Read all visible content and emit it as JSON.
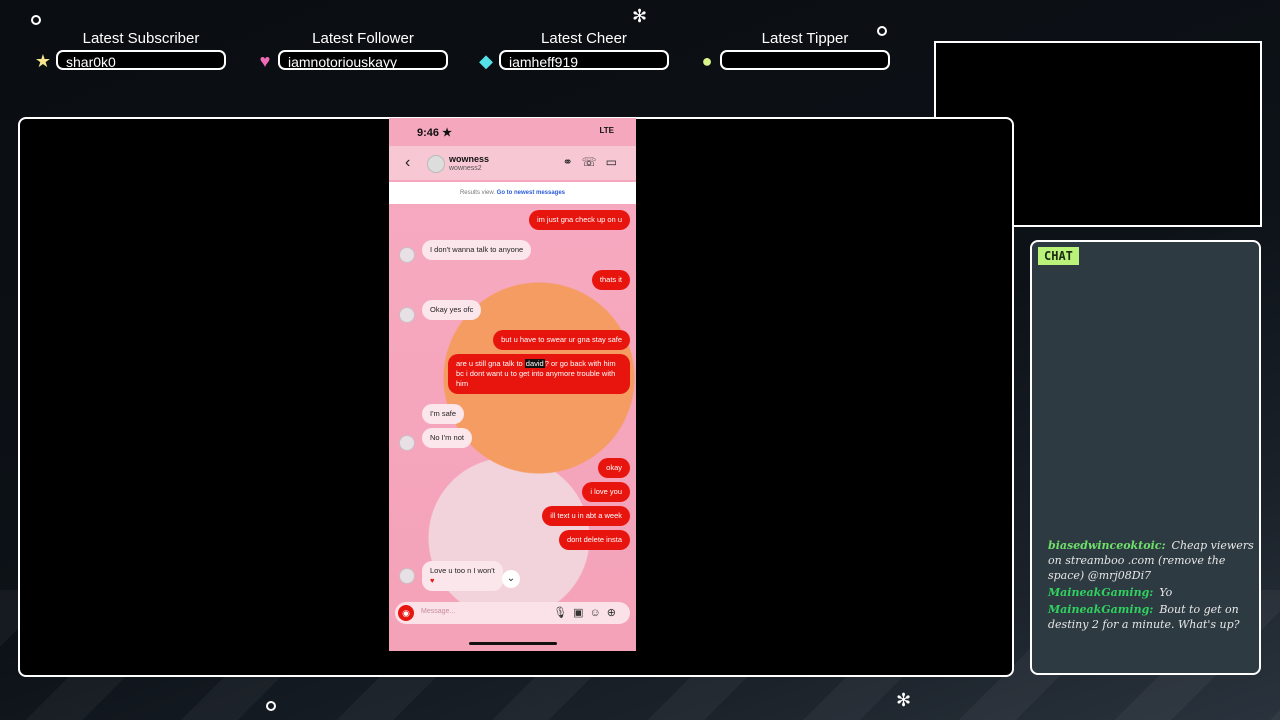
{
  "alerts": [
    {
      "title": "Latest Subscriber",
      "value": "shar0k0",
      "icon": "star-icon",
      "color": "#f6e58d"
    },
    {
      "title": "Latest Follower",
      "value": "iamnotoriouskayy",
      "icon": "heart-icon",
      "color": "#f06bb5"
    },
    {
      "title": "Latest Cheer",
      "value": "iamheff919",
      "icon": "diamond-icon",
      "color": "#56e1e8"
    },
    {
      "title": "Latest Tipper",
      "value": "",
      "icon": "coin-icon",
      "color": "#d9f58a"
    }
  ],
  "chat": {
    "tab_label": "CHAT",
    "messages": [
      {
        "user": "biasedwinceoktoic:",
        "text": "Cheap viewers on streamboo .com (remove the space) @mrj08Di7"
      },
      {
        "user": "MaineakGaming:",
        "text": "Yo"
      },
      {
        "user": "MaineakGaming:",
        "text": "Bout to get on destiny 2 for a minute. What's up?"
      }
    ]
  },
  "phone": {
    "status_time": "9:46 ★",
    "status_right": "LTE",
    "contact_name": "wowness",
    "contact_handle": "wowness2",
    "result_text": "Results view.",
    "result_link": "Go to newest messages",
    "messages": [
      {
        "dir": "out",
        "text": "im just gna check up on u"
      },
      {
        "dir": "in",
        "text": "I don't wanna talk to anyone"
      },
      {
        "dir": "out",
        "text": "thats it"
      },
      {
        "dir": "in",
        "text": "Okay yes ofc"
      },
      {
        "dir": "out",
        "text": "but u have to swear ur gna stay safe"
      },
      {
        "dir": "out",
        "text_pre": "are u still gna talk to ",
        "highlight": "david",
        "text_post": "? or go back with him bc i dont want u to get into anymore trouble with him"
      },
      {
        "dir": "in",
        "text": "I'm safe"
      },
      {
        "dir": "in",
        "text": "No I'm not"
      },
      {
        "dir": "out",
        "text": "okay"
      },
      {
        "dir": "out",
        "text": "i love you"
      },
      {
        "dir": "out",
        "text": "ill text u in abt a week"
      },
      {
        "dir": "out",
        "text": "dont delete insta"
      },
      {
        "dir": "in",
        "text": "Love u too n I won't"
      }
    ],
    "composer_placeholder": "Message..."
  }
}
